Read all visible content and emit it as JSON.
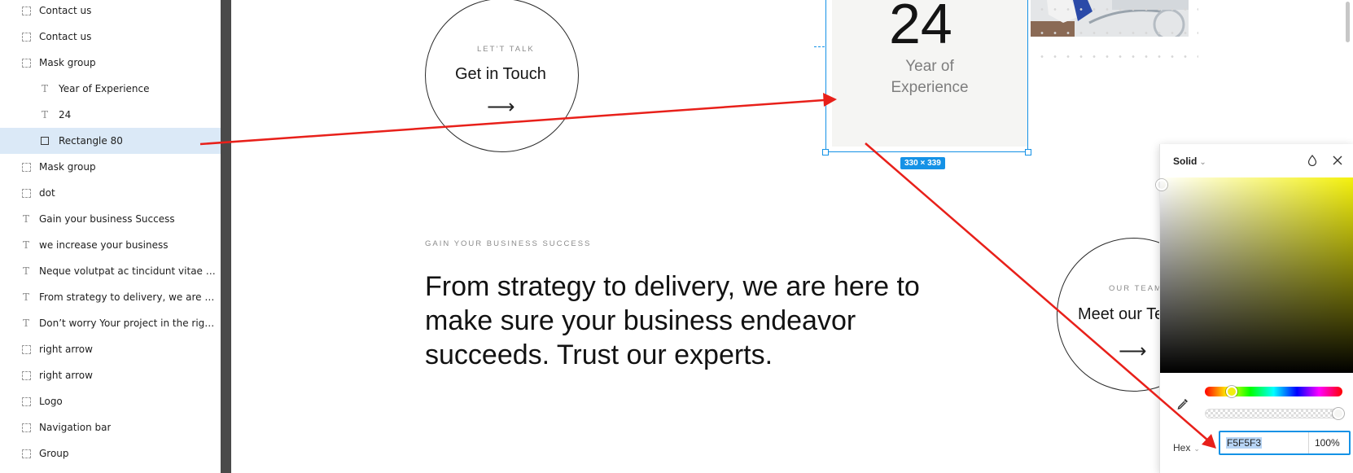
{
  "layers_panel": {
    "items": [
      {
        "label": "Contact us",
        "icon": "frame-icon"
      },
      {
        "label": "Contact us",
        "icon": "frame-icon"
      },
      {
        "label": "Mask group",
        "icon": "frame-icon"
      },
      {
        "label": "Year of Experience",
        "icon": "text-icon"
      },
      {
        "label": "24",
        "icon": "text-icon"
      },
      {
        "label": "Rectangle 80",
        "icon": "rectangle-icon",
        "selected": true
      },
      {
        "label": "Mask group",
        "icon": "frame-icon"
      },
      {
        "label": "dot",
        "icon": "frame-icon"
      },
      {
        "label": "Gain your business Success",
        "icon": "text-icon"
      },
      {
        "label": "we increase your business",
        "icon": "text-icon"
      },
      {
        "label": "Neque volutpat ac tincidunt vitae semp...",
        "icon": "text-icon"
      },
      {
        "label": "From strategy to delivery, we are here ...",
        "icon": "text-icon"
      },
      {
        "label": "Don’t worry Your project in the right ha...",
        "icon": "text-icon"
      },
      {
        "label": "right arrow",
        "icon": "frame-icon"
      },
      {
        "label": "right arrow",
        "icon": "frame-icon"
      },
      {
        "label": "Logo",
        "icon": "frame-icon"
      },
      {
        "label": "Navigation bar",
        "icon": "frame-icon"
      },
      {
        "label": "Group",
        "icon": "frame-icon"
      }
    ]
  },
  "canvas": {
    "contact_circle": {
      "eyebrow": "LET’T TALK",
      "title": "Get in Touch",
      "arrow": "⟶"
    },
    "experience_card": {
      "number": "24",
      "line1": "Year of",
      "line2": "Experience",
      "fill": "#F5F5F3"
    },
    "selection": {
      "dimensions": "330 × 339"
    },
    "section_eyebrow": "GAIN YOUR BUSINESS SUCCESS",
    "headline": {
      "line1": "From strategy to delivery, we are here to",
      "line2": "make sure your business endeavor",
      "line3": "succeeds. Trust our experts."
    },
    "team_circle": {
      "eyebrow": "OUR TEAM",
      "title": "Meet our Team",
      "arrow": "⟶"
    }
  },
  "color_picker": {
    "fill_type": "Solid",
    "mode_label": "Hex",
    "hex_value": "F5F5F3",
    "opacity": "100%",
    "icons": [
      "drop-icon",
      "close-icon",
      "eyedropper-icon"
    ]
  },
  "colors": {
    "selection_blue": "#1592e6",
    "annotation_red": "#e8201a",
    "panel_divider": "#4a4a4a",
    "selected_layer_bg": "#dbe9f7"
  }
}
